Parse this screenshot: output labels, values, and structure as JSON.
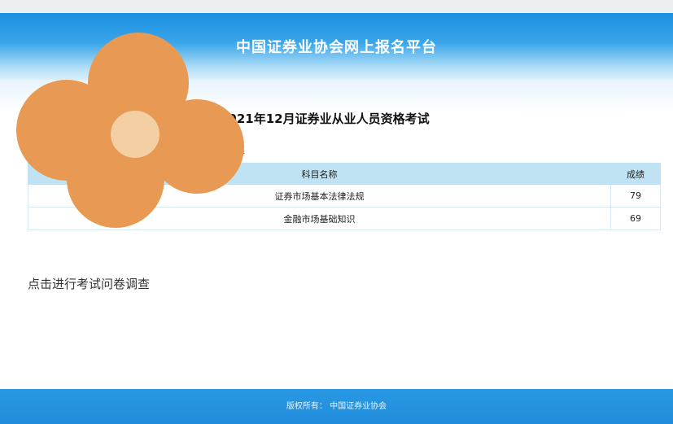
{
  "header": {
    "title": "中国证券业协会网上报名平台"
  },
  "exam": {
    "title": "2021年12月证券业从业人员资格考试",
    "candidate_name_visible": "鑫"
  },
  "results_table": {
    "headers": {
      "subject": "科目名称",
      "score": "成绩"
    },
    "rows": [
      {
        "subject": "证券市场基本法律法规",
        "score": "79"
      },
      {
        "subject": "金融市场基础知识",
        "score": "69"
      }
    ]
  },
  "survey": {
    "link_text": "点击进行考试问卷调查"
  },
  "footer": {
    "text": "版权所有：  中国证券业协会"
  },
  "colors": {
    "header_blue": "#1a8ee0",
    "table_header_bg": "#bfe3f2",
    "flower_orange": "#e89a55",
    "flower_center": "#f3cfa3"
  }
}
